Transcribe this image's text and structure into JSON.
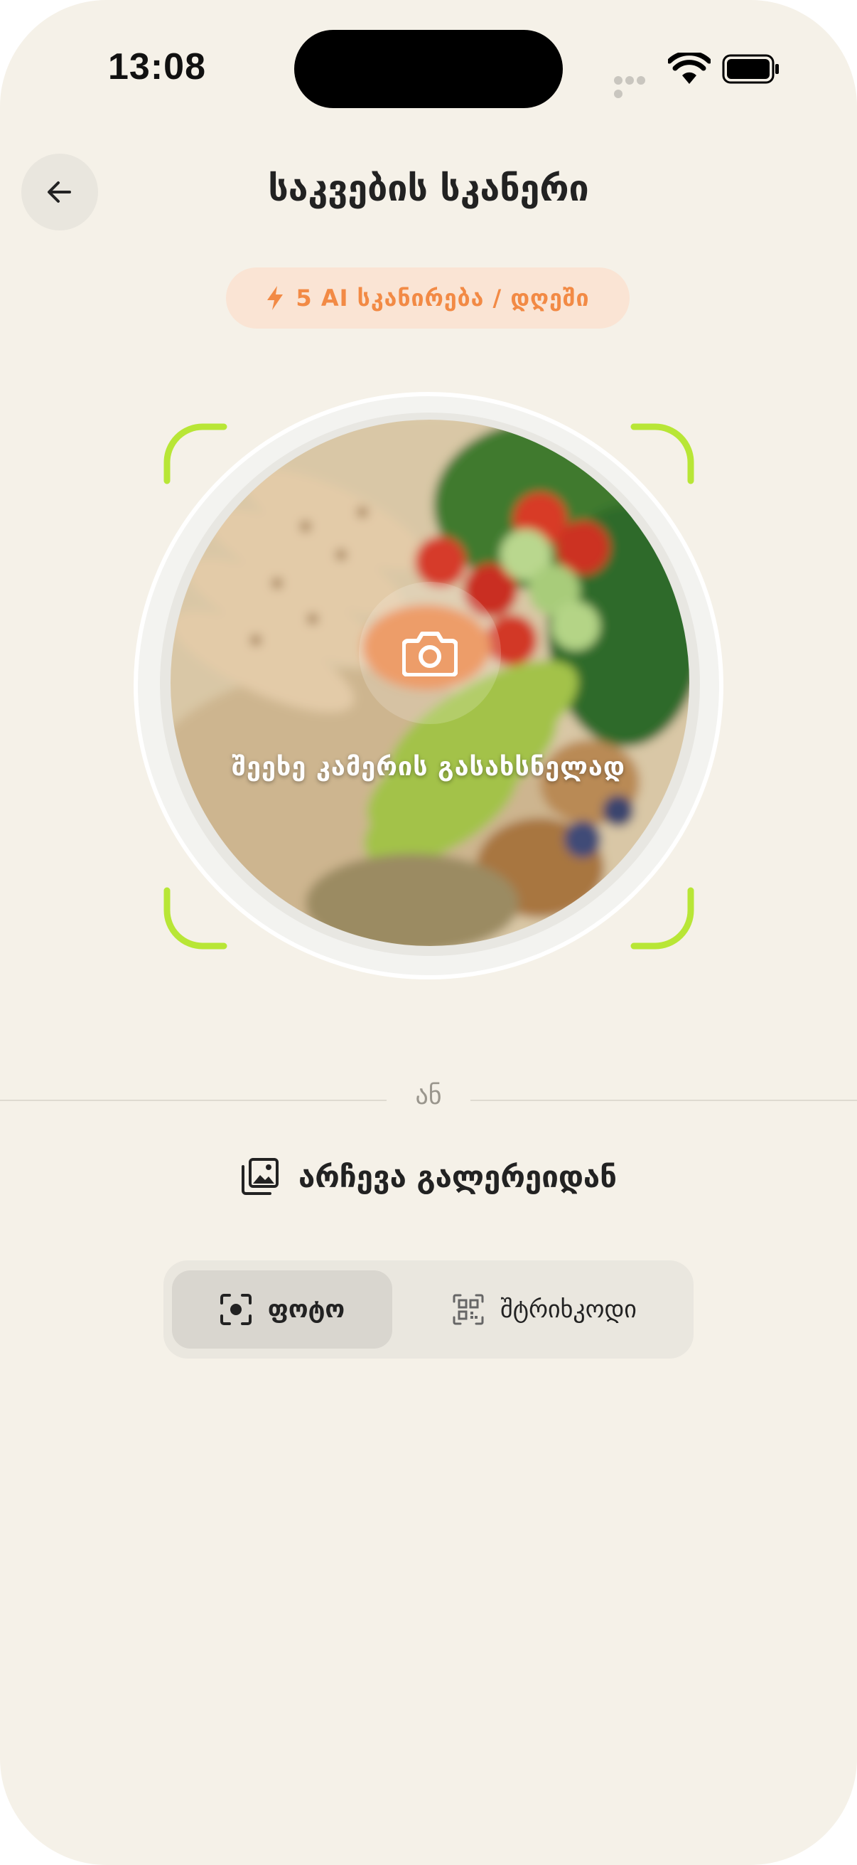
{
  "status_bar": {
    "time": "13:08"
  },
  "header": {
    "title": "საკვების სკანერი",
    "back_icon": "arrow-left-icon"
  },
  "ai_badge": {
    "icon": "lightning-icon",
    "text": "5 AI სკანირება / დღეში",
    "color": "#F28A45"
  },
  "scanner": {
    "camera_icon": "camera-icon",
    "hint": "შეეხე კამერის გასახსნელად",
    "frame_color": "#B8E636"
  },
  "divider": {
    "label": "ან"
  },
  "gallery": {
    "icon": "gallery-icon",
    "label": "არჩევა გალერეიდან"
  },
  "mode_tabs": [
    {
      "label": "ფოტო",
      "icon": "scan-focus-icon",
      "active": true
    },
    {
      "label": "შტრიხკოდი",
      "icon": "qr-code-icon",
      "active": false
    }
  ]
}
